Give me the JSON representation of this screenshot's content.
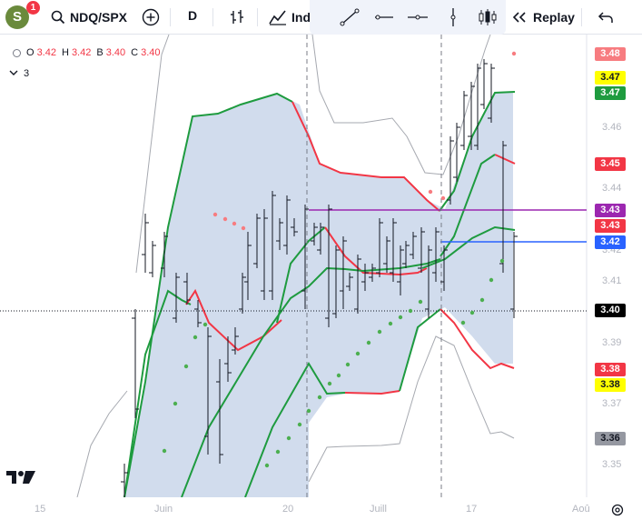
{
  "toolbar": {
    "avatar_letter": "S",
    "notification_count": "1",
    "symbol": "NDQ/SPX",
    "interval": "D",
    "indicators_label": "Ind",
    "replay_label": "Replay"
  },
  "legend": {
    "o_label": "O",
    "o_value": "3.42",
    "h_label": "H",
    "h_value": "3.42",
    "l_label": "B",
    "l_value": "3.40",
    "c_label": "C",
    "c_value": "3.40",
    "indicator_count": "3"
  },
  "price_axis": {
    "labels": [
      "3.46",
      "3.44",
      "3.42",
      "3.41",
      "3.39",
      "3.37",
      "3.35"
    ],
    "tags": [
      {
        "value": "3.48",
        "bg": "#f77c80",
        "fg": "#ffffff"
      },
      {
        "value": "3.47",
        "bg": "#ffff00",
        "fg": "#131722"
      },
      {
        "value": "3.47",
        "bg": "#1e9b3f",
        "fg": "#ffffff"
      },
      {
        "value": "3.45",
        "bg": "#f23645",
        "fg": "#ffffff"
      },
      {
        "value": "3.43",
        "bg": "#9c27b0",
        "fg": "#ffffff"
      },
      {
        "value": "3.43",
        "bg": "#f23645",
        "fg": "#ffffff"
      },
      {
        "value": "3.42",
        "bg": "#2962ff",
        "fg": "#ffffff"
      },
      {
        "value": "3.40",
        "bg": "#000000",
        "fg": "#ffffff"
      },
      {
        "value": "3.38",
        "bg": "#f23645",
        "fg": "#ffffff"
      },
      {
        "value": "3.38",
        "bg": "#ffff00",
        "fg": "#131722"
      },
      {
        "value": "3.36",
        "bg": "#9598a1",
        "fg": "#131722"
      }
    ]
  },
  "time_axis": {
    "labels": [
      "15",
      "Juin",
      "20",
      "Juill",
      "17",
      "Aoû"
    ]
  },
  "colors": {
    "band_fill": "#c9d6ea",
    "green_line": "#1e9b3f",
    "red_line": "#f23645",
    "gray_line": "#a6a9b0",
    "sar_green": "#4caf50",
    "sar_red": "#f77c80",
    "purple_line": "#9c27b0",
    "blue_line": "#2962ff"
  },
  "chart_data": {
    "type": "line",
    "symbol": "NDQ/SPX",
    "interval": "D",
    "last_ohlc": {
      "open": 3.42,
      "high": 3.42,
      "low": 3.4,
      "close": 3.4
    },
    "horizontal_levels": [
      3.43,
      3.42,
      3.4
    ],
    "series": [
      {
        "name": "upper-band",
        "values": [
          3.44,
          3.455,
          3.46,
          3.462,
          3.465,
          3.466,
          3.467,
          3.466,
          3.462,
          3.455,
          3.448,
          3.447,
          3.445,
          3.443,
          3.447,
          3.455,
          3.465,
          3.47,
          3.47
        ]
      },
      {
        "name": "lower-band",
        "values": [
          3.33,
          3.35,
          3.365,
          3.375,
          3.385,
          3.392,
          3.398,
          3.403,
          3.408,
          3.41,
          3.412,
          3.413,
          3.415,
          3.417,
          3.42,
          3.425,
          3.435,
          3.44,
          3.442
        ]
      }
    ]
  }
}
